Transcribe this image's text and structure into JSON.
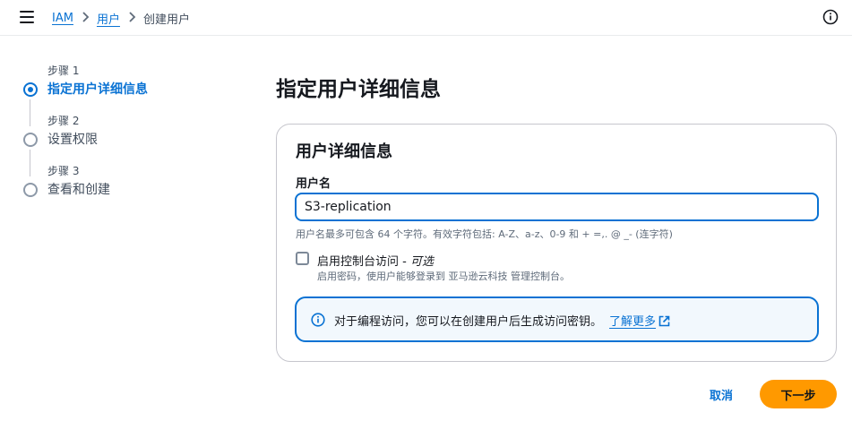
{
  "breadcrumb": {
    "items": [
      "IAM",
      "用户",
      "创建用户"
    ],
    "separator": ">"
  },
  "steps": [
    {
      "number": "步骤 1",
      "title": "指定用户详细信息",
      "active": true
    },
    {
      "number": "步骤 2",
      "title": "设置权限",
      "active": false
    },
    {
      "number": "步骤 3",
      "title": "查看和创建",
      "active": false
    }
  ],
  "page_title": "指定用户详细信息",
  "card": {
    "title": "用户详细信息",
    "username_label": "用户名",
    "username_value": "S3-replication",
    "username_hint": "用户名最多可包含 64 个字符。有效字符包括: A-Z、a-z、0-9 和 + =,. @ _- (连字符)",
    "console_access_label": "启用控制台访问 - ",
    "console_access_optional": "可选",
    "console_access_checked": false,
    "console_access_desc": "启用密码，使用户能够登录到 亚马逊云科技 管理控制台。",
    "alert_text": "对于编程访问，您可以在创建用户后生成访问密钥。",
    "alert_link": "了解更多"
  },
  "actions": {
    "cancel": "取消",
    "next": "下一步"
  },
  "colors": {
    "primary_blue": "#0972d3",
    "next_button": "#ff9900",
    "alert_bg": "#f2f8fd"
  },
  "icons": [
    "menu-icon",
    "info-icon",
    "external-link-icon"
  ]
}
